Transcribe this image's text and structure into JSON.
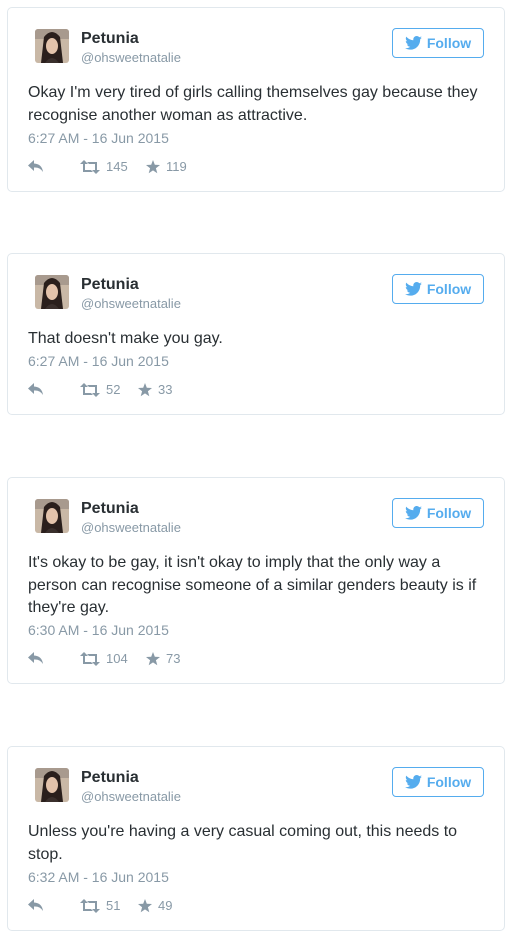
{
  "tweets": [
    {
      "name": "Petunia",
      "handle": "@ohsweetnatalie",
      "follow_label": "Follow",
      "text": "Okay I'm very tired of girls calling themselves gay because they recognise another woman as attractive.",
      "timestamp": "6:27 AM - 16 Jun 2015",
      "retweets": "145",
      "favorites": "119"
    },
    {
      "name": "Petunia",
      "handle": "@ohsweetnatalie",
      "follow_label": "Follow",
      "text": "That doesn't make you gay.",
      "timestamp": "6:27 AM - 16 Jun 2015",
      "retweets": "52",
      "favorites": "33"
    },
    {
      "name": "Petunia",
      "handle": "@ohsweetnatalie",
      "follow_label": "Follow",
      "text": "It's okay to be gay, it isn't okay to imply that the only way a person can recognise someone of a similar genders beauty is if they're gay.",
      "timestamp": "6:30 AM - 16 Jun 2015",
      "retweets": "104",
      "favorites": "73"
    },
    {
      "name": "Petunia",
      "handle": "@ohsweetnatalie",
      "follow_label": "Follow",
      "text": "Unless you're having a very casual coming out, this needs to stop.",
      "timestamp": "6:32 AM - 16 Jun 2015",
      "retweets": "51",
      "favorites": "49"
    }
  ],
  "colors": {
    "twitter_blue": "#55acee",
    "muted_gray": "#8899a6",
    "text_dark": "#292f33",
    "border": "#e1e8ed"
  },
  "icons": {
    "follow": "twitter-bird-icon",
    "reply": "reply-icon",
    "retweet": "retweet-icon",
    "favorite": "star-icon"
  }
}
